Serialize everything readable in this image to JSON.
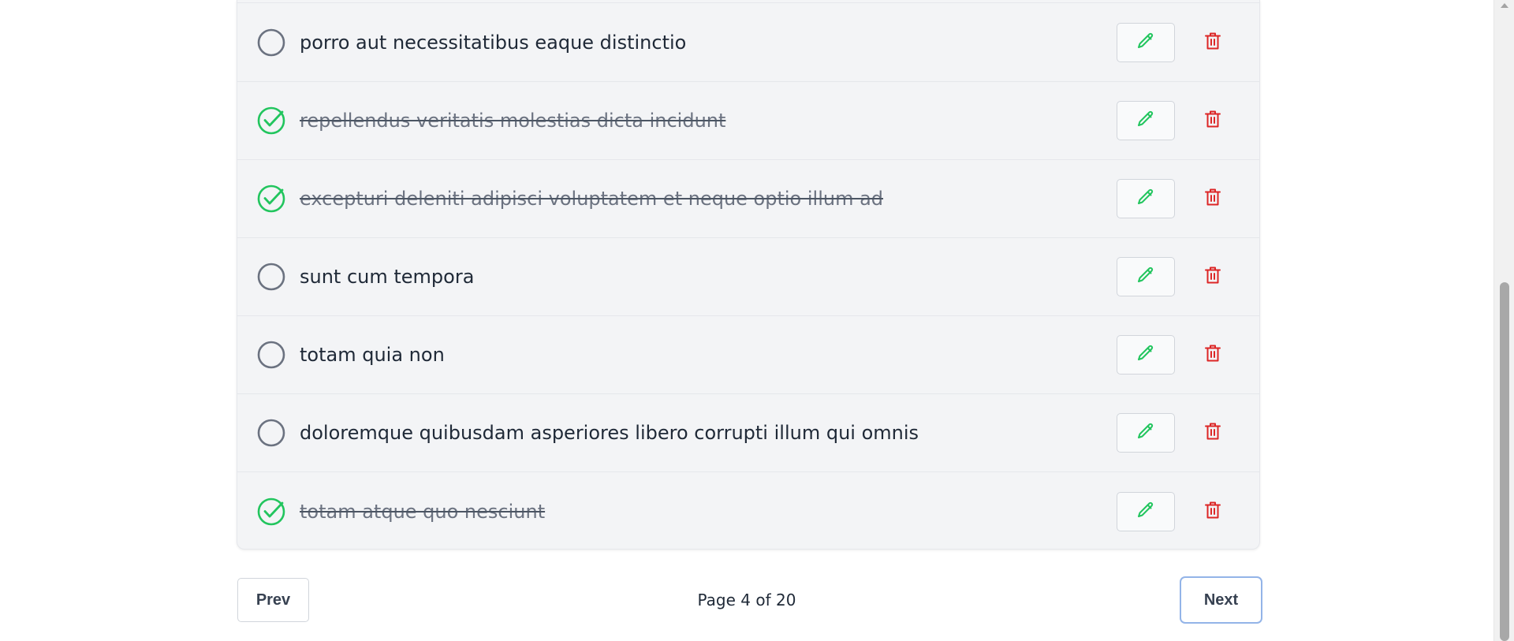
{
  "todos": [
    {
      "text": "porro aut necessitatibus eaque distinctio",
      "completed": false
    },
    {
      "text": "repellendus veritatis molestias dicta incidunt",
      "completed": true
    },
    {
      "text": "excepturi deleniti adipisci voluptatem et neque optio illum ad",
      "completed": true
    },
    {
      "text": "sunt cum tempora",
      "completed": false
    },
    {
      "text": "totam quia non",
      "completed": false
    },
    {
      "text": "doloremque quibusdam asperiores libero corrupti illum qui omnis",
      "completed": false
    },
    {
      "text": "totam atque quo nesciunt",
      "completed": true
    }
  ],
  "pagination": {
    "prev_label": "Prev",
    "next_label": "Next",
    "page_text": "Page 4 of 20",
    "current_page": 4,
    "total_pages": 20
  },
  "icons": {
    "incomplete": "circle-icon",
    "complete": "check-circle-icon",
    "edit": "pencil-icon",
    "delete": "trash-icon"
  },
  "colors": {
    "complete": "#22c55e",
    "incomplete": "#6b7280",
    "edit": "#22c55e",
    "delete": "#dc2626",
    "focus_ring": "#93b4e8"
  }
}
